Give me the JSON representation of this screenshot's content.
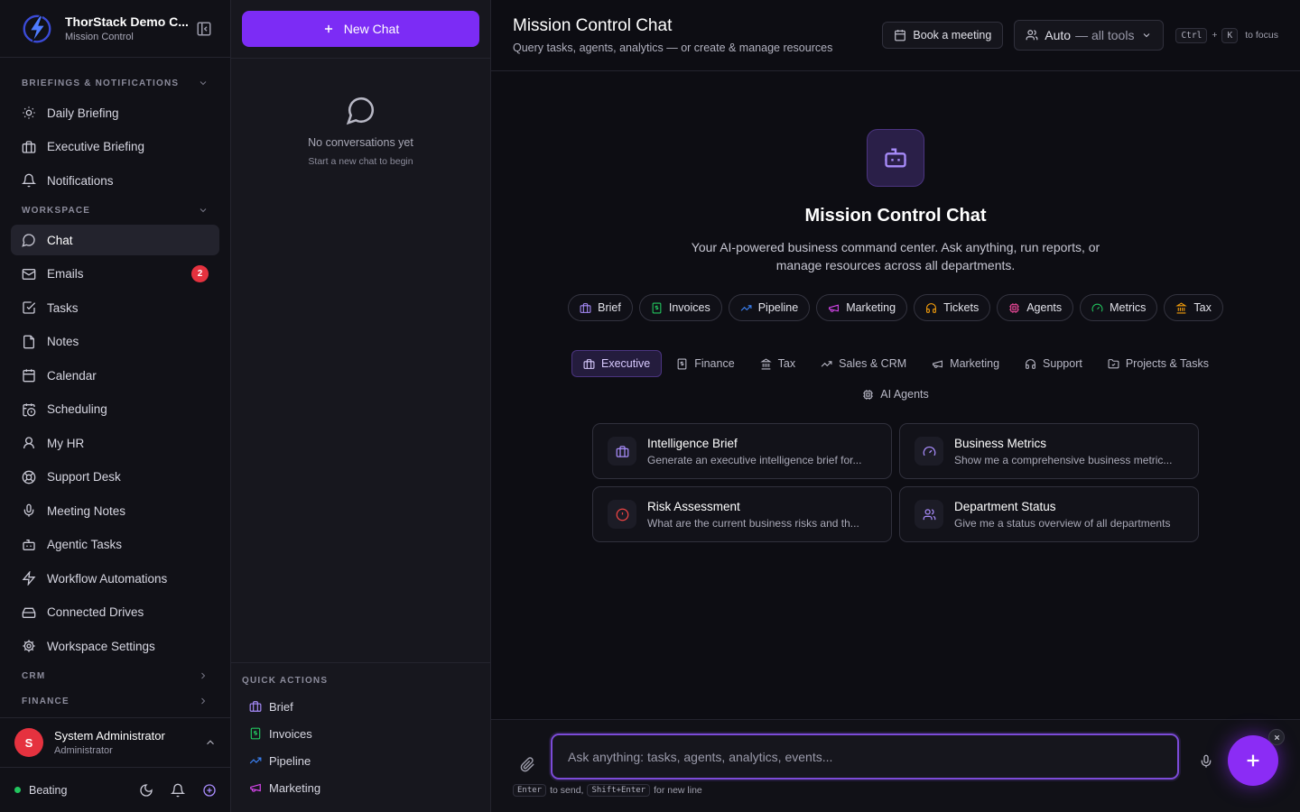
{
  "brand": {
    "title": "ThorStack Demo C...",
    "subtitle": "Mission Control"
  },
  "sidebar": {
    "sections": [
      {
        "label": "BRIEFINGS & NOTIFICATIONS"
      },
      {
        "label": "WORKSPACE"
      },
      {
        "label": "CRM"
      },
      {
        "label": "FINANCE"
      }
    ],
    "briefings": [
      {
        "label": "Daily Briefing",
        "icon": "sun-icon"
      },
      {
        "label": "Executive Briefing",
        "icon": "briefcase-icon"
      },
      {
        "label": "Notifications",
        "icon": "bell-icon"
      }
    ],
    "workspace": [
      {
        "label": "Chat",
        "icon": "chat-icon",
        "active": true
      },
      {
        "label": "Emails",
        "icon": "mail-icon",
        "badge": "2"
      },
      {
        "label": "Tasks",
        "icon": "checkbox-icon"
      },
      {
        "label": "Notes",
        "icon": "file-icon"
      },
      {
        "label": "Calendar",
        "icon": "calendar-icon"
      },
      {
        "label": "Scheduling",
        "icon": "calendar-clock-icon"
      },
      {
        "label": "My HR",
        "icon": "user-icon"
      },
      {
        "label": "Support Desk",
        "icon": "lifebuoy-icon"
      },
      {
        "label": "Meeting Notes",
        "icon": "mic-icon"
      },
      {
        "label": "Agentic Tasks",
        "icon": "robot-icon"
      },
      {
        "label": "Workflow Automations",
        "icon": "bolt-icon"
      },
      {
        "label": "Connected Drives",
        "icon": "drive-icon"
      },
      {
        "label": "Workspace Settings",
        "icon": "gear-icon"
      }
    ]
  },
  "user": {
    "initial": "S",
    "name": "System Administrator",
    "role": "Administrator"
  },
  "status": {
    "label": "Beating",
    "color": "#22c55e"
  },
  "convo": {
    "new_chat": "New Chat",
    "empty_title": "No conversations yet",
    "empty_sub": "Start a new chat to begin",
    "quick_actions_title": "QUICK ACTIONS",
    "quick_actions": [
      {
        "label": "Brief",
        "icon": "briefcase-icon",
        "color": "#a78bfa"
      },
      {
        "label": "Invoices",
        "icon": "invoice-icon",
        "color": "#22c55e"
      },
      {
        "label": "Pipeline",
        "icon": "trend-icon",
        "color": "#3b82f6"
      },
      {
        "label": "Marketing",
        "icon": "megaphone-icon",
        "color": "#d946ef"
      }
    ]
  },
  "header": {
    "title": "Mission Control Chat",
    "subtitle": "Query tasks, agents, analytics — or create & manage resources",
    "book": "Book a meeting",
    "mode": "Auto",
    "mode_dim": "— all tools",
    "kbd1": "Ctrl",
    "kbd_plus": "+",
    "kbd2": "K",
    "kbd_hint": "to focus"
  },
  "hero": {
    "title": "Mission Control Chat",
    "desc": "Your AI-powered business command center. Ask anything, run reports, or manage resources across all departments."
  },
  "chips": [
    {
      "label": "Brief",
      "icon": "briefcase-icon",
      "color": "#a78bfa"
    },
    {
      "label": "Invoices",
      "icon": "invoice-icon",
      "color": "#22c55e"
    },
    {
      "label": "Pipeline",
      "icon": "trend-icon",
      "color": "#3b82f6"
    },
    {
      "label": "Marketing",
      "icon": "megaphone-icon",
      "color": "#d946ef"
    },
    {
      "label": "Tickets",
      "icon": "headset-icon",
      "color": "#f59e0b"
    },
    {
      "label": "Agents",
      "icon": "chip-icon",
      "color": "#ec4899"
    },
    {
      "label": "Metrics",
      "icon": "gauge-icon",
      "color": "#22c55e"
    },
    {
      "label": "Tax",
      "icon": "bank-icon",
      "color": "#f59e0b"
    }
  ],
  "tabs": [
    {
      "label": "Executive",
      "icon": "briefcase-icon",
      "active": true
    },
    {
      "label": "Finance",
      "icon": "invoice-icon"
    },
    {
      "label": "Tax",
      "icon": "bank-icon"
    },
    {
      "label": "Sales & CRM",
      "icon": "trend-icon"
    },
    {
      "label": "Marketing",
      "icon": "megaphone-icon"
    },
    {
      "label": "Support",
      "icon": "headset-icon"
    },
    {
      "label": "Projects & Tasks",
      "icon": "folder-icon"
    },
    {
      "label": "AI Agents",
      "icon": "chip-icon"
    }
  ],
  "cards": [
    {
      "title": "Intelligence Brief",
      "desc": "Generate an executive intelligence brief for...",
      "icon": "briefcase-icon",
      "color": "#a78bfa"
    },
    {
      "title": "Business Metrics",
      "desc": "Show me a comprehensive business metric...",
      "icon": "gauge-icon",
      "color": "#a78bfa"
    },
    {
      "title": "Risk Assessment",
      "desc": "What are the current business risks and th...",
      "icon": "alert-icon",
      "color": "#ef4444"
    },
    {
      "title": "Department Status",
      "desc": "Give me a status overview of all departments",
      "icon": "users-icon",
      "color": "#a78bfa"
    }
  ],
  "composer": {
    "placeholder": "Ask anything: tasks, agents, analytics, events...",
    "enter": "Enter",
    "enter_hint": "to send,",
    "shift": "Shift+Enter",
    "shift_hint": "for new line"
  },
  "colors": {
    "accent": "#7c2cf5",
    "danger": "#e5323f"
  }
}
